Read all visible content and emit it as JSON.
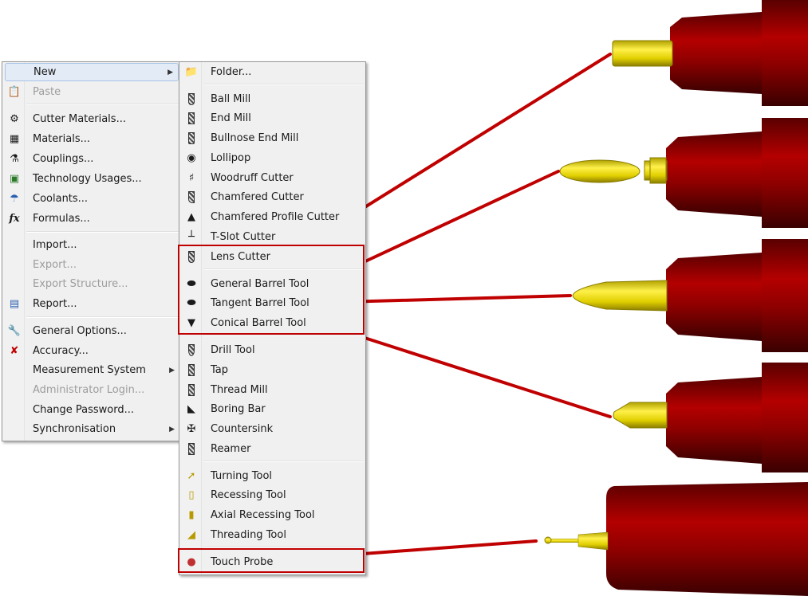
{
  "main_menu": {
    "items": [
      {
        "label": "New",
        "icon": "new-icon",
        "disabled": false,
        "submenu": true,
        "highlighted": true
      },
      {
        "label": "Paste",
        "icon": "paste-icon",
        "disabled": true
      },
      {
        "label": "Cutter Materials...",
        "icon": "cutter-materials-icon",
        "disabled": false
      },
      {
        "label": "Materials...",
        "icon": "materials-icon",
        "disabled": false
      },
      {
        "label": "Couplings...",
        "icon": "couplings-icon",
        "disabled": false
      },
      {
        "label": "Technology Usages...",
        "icon": "technology-usages-icon",
        "disabled": false
      },
      {
        "label": "Coolants...",
        "icon": "coolants-icon",
        "disabled": false
      },
      {
        "label": "Formulas...",
        "icon": "formulas-icon",
        "disabled": false
      },
      {
        "label": "Import...",
        "icon": "",
        "disabled": false
      },
      {
        "label": "Export...",
        "icon": "",
        "disabled": true
      },
      {
        "label": "Export Structure...",
        "icon": "",
        "disabled": true
      },
      {
        "label": "Report...",
        "icon": "report-icon",
        "disabled": false
      },
      {
        "label": "General Options...",
        "icon": "wrench-icon",
        "disabled": false
      },
      {
        "label": "Accuracy...",
        "icon": "accuracy-icon",
        "disabled": false
      },
      {
        "label": "Measurement System",
        "icon": "",
        "disabled": false,
        "submenu": true
      },
      {
        "label": "Administrator Login...",
        "icon": "",
        "disabled": true
      },
      {
        "label": "Change Password...",
        "icon": "",
        "disabled": false
      },
      {
        "label": "Synchronisation",
        "icon": "",
        "disabled": false,
        "submenu": true
      }
    ]
  },
  "sub_menu": {
    "items": [
      {
        "label": "Folder...",
        "icon": "folder-icon"
      },
      {
        "label": "Ball Mill",
        "icon": "ball-mill-icon"
      },
      {
        "label": "End Mill",
        "icon": "end-mill-icon"
      },
      {
        "label": "Bullnose End Mill",
        "icon": "bullnose-end-mill-icon"
      },
      {
        "label": "Lollipop",
        "icon": "lollipop-icon"
      },
      {
        "label": "Woodruff Cutter",
        "icon": "woodruff-cutter-icon"
      },
      {
        "label": "Chamfered Cutter",
        "icon": "chamfered-cutter-icon"
      },
      {
        "label": "Chamfered Profile Cutter",
        "icon": "chamfered-profile-cutter-icon"
      },
      {
        "label": "T-Slot Cutter",
        "icon": "t-slot-cutter-icon"
      },
      {
        "label": "Lens Cutter",
        "icon": "lens-cutter-icon"
      },
      {
        "label": "General Barrel Tool",
        "icon": "general-barrel-tool-icon"
      },
      {
        "label": "Tangent Barrel Tool",
        "icon": "tangent-barrel-tool-icon"
      },
      {
        "label": "Conical Barrel Tool",
        "icon": "conical-barrel-tool-icon"
      },
      {
        "label": "Drill Tool",
        "icon": "drill-tool-icon"
      },
      {
        "label": "Tap",
        "icon": "tap-icon"
      },
      {
        "label": "Thread Mill",
        "icon": "thread-mill-icon"
      },
      {
        "label": "Boring Bar",
        "icon": "boring-bar-icon"
      },
      {
        "label": "Countersink",
        "icon": "countersink-icon"
      },
      {
        "label": "Reamer",
        "icon": "reamer-icon"
      },
      {
        "label": "Turning Tool",
        "icon": "turning-tool-icon"
      },
      {
        "label": "Recessing Tool",
        "icon": "recessing-tool-icon"
      },
      {
        "label": "Axial Recessing Tool",
        "icon": "axial-recessing-tool-icon"
      },
      {
        "label": "Threading Tool",
        "icon": "threading-tool-icon"
      },
      {
        "label": "Touch Probe",
        "icon": "touch-probe-icon"
      }
    ]
  },
  "colors": {
    "highlight_box": "#c00000",
    "tool_body": "#8b0000",
    "tool_tip": "#e8d800"
  }
}
